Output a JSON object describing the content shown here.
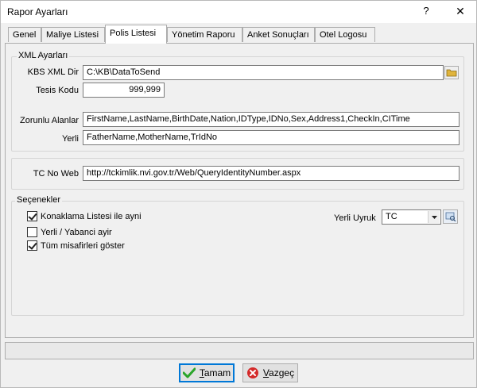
{
  "window": {
    "title": "Rapor Ayarları",
    "help": "?",
    "close": "✕"
  },
  "tabs": [
    {
      "label": "Genel"
    },
    {
      "label": "Maliye Listesi"
    },
    {
      "label": "Polis Listesi"
    },
    {
      "label": "Yönetim Raporu"
    },
    {
      "label": "Anket Sonuçları"
    },
    {
      "label": "Otel Logosu"
    }
  ],
  "xml_settings": {
    "legend": "XML Ayarları",
    "kbs_dir_label": "KBS XML Dir",
    "kbs_dir_value": "C:\\KB\\DataToSend",
    "tesis_kodu_label": "Tesis Kodu",
    "tesis_kodu_value": "999,999",
    "zorunlu_label": "Zorunlu Alanlar",
    "zorunlu_value": "FirstName,LastName,BirthDate,Nation,IDType,IDNo,Sex,Address1,CheckIn,CITime",
    "yerli_label": "Yerli",
    "yerli_value": "FatherName,MotherName,TrIdNo"
  },
  "tc_web": {
    "label": "TC No Web",
    "value": "http://tckimlik.nvi.gov.tr/Web/QueryIdentityNumber.aspx"
  },
  "options": {
    "legend": "Seçenekler",
    "checkboxes": [
      {
        "label": "Konaklama Listesi ile ayni",
        "checked": true
      },
      {
        "label": "Yerli / Yabanci ayir",
        "checked": false
      },
      {
        "label": "Tüm misafirleri göster",
        "checked": true
      }
    ],
    "yerli_uyruk_label": "Yerli Uyruk",
    "yerli_uyruk_value": "TC"
  },
  "buttons": {
    "ok_prefix": "",
    "ok_mnemonic": "T",
    "ok_rest": "amam",
    "cancel_prefix": "",
    "cancel_mnemonic": "V",
    "cancel_rest": "azgeç"
  },
  "colors": {
    "ok_icon": "#2aa52a",
    "cancel_icon": "#d42a2a",
    "folder_icon": "#e0b43c"
  }
}
